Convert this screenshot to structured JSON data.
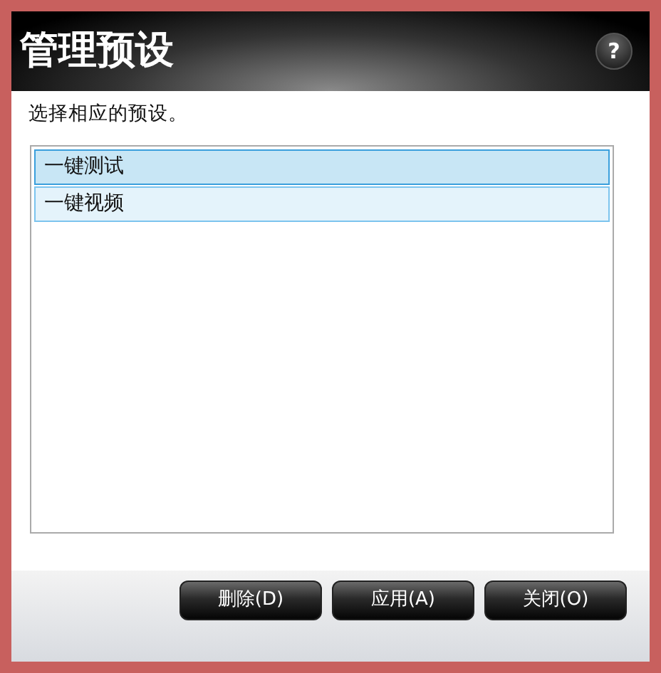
{
  "window": {
    "title": "管理预设",
    "help": "?"
  },
  "instruction": "选择相应的预设。",
  "presets": [
    {
      "label": "一键测试",
      "selected": true,
      "hover": false
    },
    {
      "label": "一键视频",
      "selected": false,
      "hover": true
    }
  ],
  "buttons": [
    "删除(D)",
    "应用(A)",
    "关闭(O)"
  ]
}
